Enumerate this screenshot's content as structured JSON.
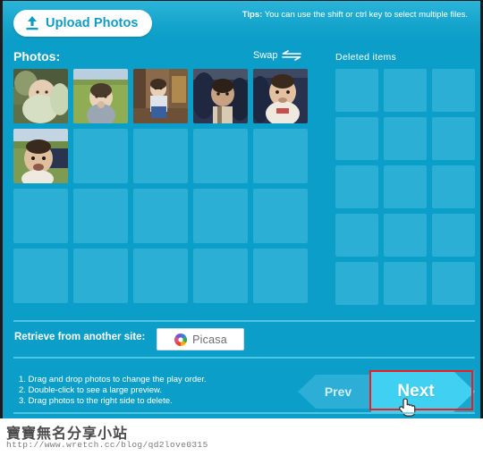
{
  "colors": {
    "background": "#0b9ec8",
    "slot": "#2bafd4",
    "accent_white": "#ffffff",
    "highlight_red": "#f21b1b",
    "next_button": "#3fd0f2",
    "prev_button": "#2caed6",
    "divider": "#5ccbe6",
    "upload_text": "#0e9bc4",
    "picasa_text": "#6d6d6d"
  },
  "toolbar": {
    "upload_label": "Upload Photos",
    "upload_icon": "upload-arrow-icon",
    "tips_prefix": "Tips:",
    "tips_text": "You can use the shift or ctrl key to select multiple files."
  },
  "photos_panel": {
    "title": "Photos:",
    "swap_label": "Swap",
    "swap_icon": "double-arrow-left-right-icon",
    "columns": 5,
    "rows": 4,
    "filled_count": 6,
    "thumbnails": [
      {
        "index": 1,
        "alt": "baby in stroller wearing green outfit"
      },
      {
        "index": 2,
        "alt": "toddler in field of green crops"
      },
      {
        "index": 3,
        "alt": "toddler standing indoors by shelf"
      },
      {
        "index": 4,
        "alt": "baby in dark patterned car seat"
      },
      {
        "index": 5,
        "alt": "smiling baby in striped bib"
      },
      {
        "index": 6,
        "alt": "toddler outdoors close-up smiling"
      }
    ]
  },
  "deleted_panel": {
    "title": "Deleted items",
    "columns": 3,
    "rows": 5,
    "filled_count": 0
  },
  "retrieve": {
    "label": "Retrieve from another site:",
    "site_button_label": "Picasa",
    "site_button_icon": "picasa-pinwheel-icon"
  },
  "instructions": [
    "1. Drag and drop photos to change the play order.",
    "2. Double-click to see a large preview.",
    "3. Drag photos to the right side to delete."
  ],
  "navigation": {
    "prev_label": "Prev",
    "next_label": "Next",
    "next_highlighted": true,
    "cursor_icon": "pointing-hand-cursor"
  },
  "footer": {
    "title": "寶寶無名分享小站",
    "url": "http://www.wretch.cc/blog/qd2love0315"
  }
}
